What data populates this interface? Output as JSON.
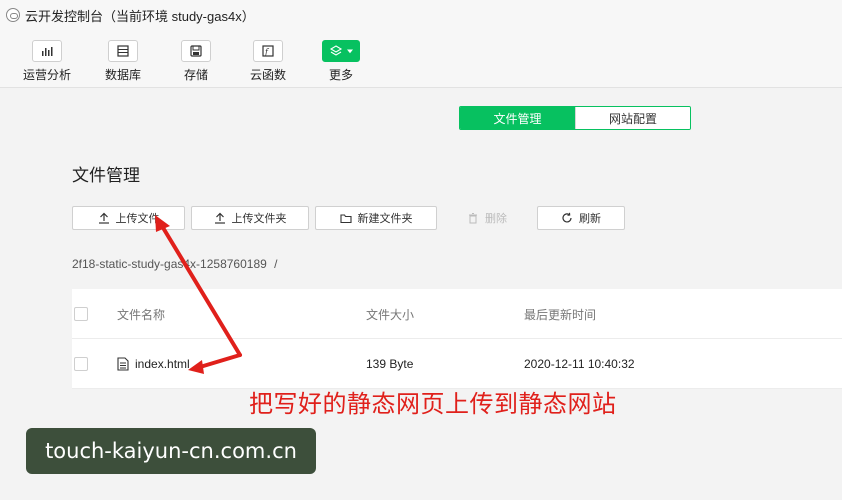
{
  "titlebar": {
    "title": "云开发控制台（当前环境 study-gas4x）"
  },
  "toolbar": {
    "items": [
      {
        "label": "运营分析",
        "icon": "bar-chart-icon"
      },
      {
        "label": "数据库",
        "icon": "database-icon"
      },
      {
        "label": "存储",
        "icon": "storage-icon"
      },
      {
        "label": "云函数",
        "icon": "function-icon"
      },
      {
        "label": "更多",
        "icon": "layers-icon"
      }
    ]
  },
  "tabs": {
    "file_manage": "文件管理",
    "site_config": "网站配置"
  },
  "page": {
    "title": "文件管理"
  },
  "actions": {
    "upload_file": "上传文件",
    "upload_folder": "上传文件夹",
    "new_folder": "新建文件夹",
    "delete": "删除",
    "refresh": "刷新"
  },
  "breadcrumb": {
    "path": "2f18-static-study-gas4x-1258760189",
    "sep": "/"
  },
  "table": {
    "headers": {
      "name": "文件名称",
      "size": "文件大小",
      "updated": "最后更新时间"
    },
    "rows": [
      {
        "name": "index.html",
        "size": "139 Byte",
        "updated": "2020-12-11 10:40:32"
      }
    ]
  },
  "annotation": "把写好的静态网页上传到静态网站",
  "watermark": "touch-kaiyun-cn.com.cn",
  "colors": {
    "accent": "#07c160",
    "annotation": "#e0201b",
    "watermark_bg": "#3d4f3b"
  }
}
